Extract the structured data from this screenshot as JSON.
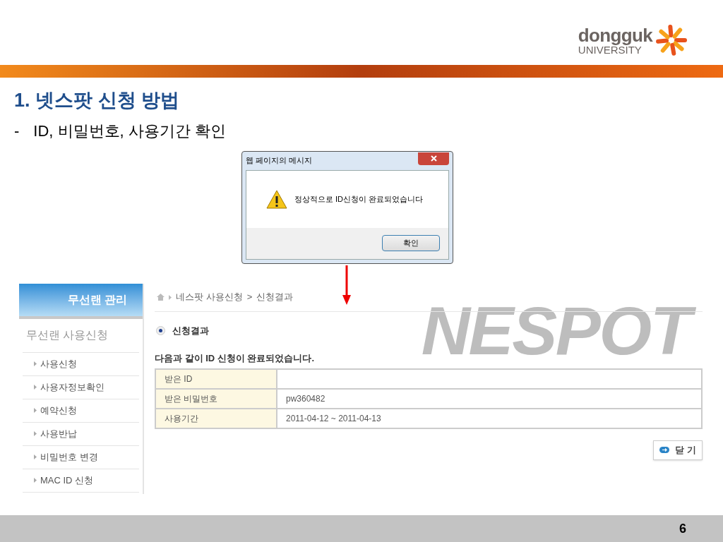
{
  "logo": {
    "name": "dongguk",
    "sub": "UNIVERSITY"
  },
  "title": "1. 넷스팟 신청 방법",
  "bullet": {
    "marker": "-",
    "text": "ID, 비밀번호, 사용기간 확인"
  },
  "dialog": {
    "title": "웹 페이지의 메시지",
    "message": "정상적으로 ID신청이 완료되었습니다",
    "button": "확인"
  },
  "web": {
    "sidebar": {
      "header": "무선랜 관리",
      "section": "무선랜 사용신청",
      "items": [
        "사용신청",
        "사용자정보확인",
        "예약신청",
        "사용반납",
        "비밀번호 변경",
        "MAC ID 신청"
      ]
    },
    "breadcrumb": {
      "items": [
        "네스팟 사용신청",
        "신청결과"
      ],
      "separator": ">"
    },
    "section_title": "신청결과",
    "message": "다음과 같이 ID 신청이 완료되었습니다.",
    "table": {
      "rows": [
        {
          "label": "받은 ID"
        },
        {
          "label": "받은 비밀번호",
          "value": "pw360482"
        },
        {
          "label": "사용기간",
          "value": "2011-04-12 ~ 2011-04-13"
        }
      ]
    },
    "close_button": "닫 기",
    "background_logo": "NESPOT"
  },
  "page_number": "6"
}
